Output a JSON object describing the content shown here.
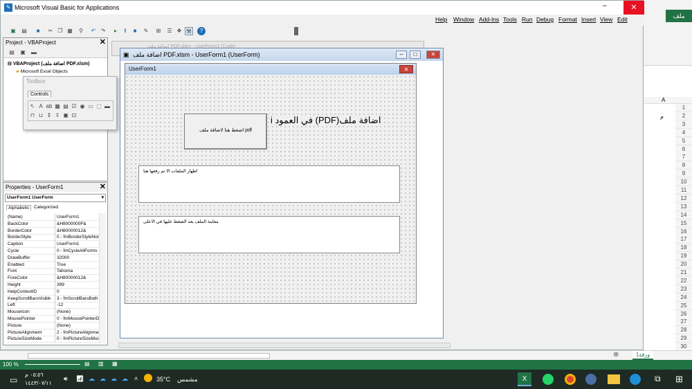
{
  "vba": {
    "title": "Microsoft Visual Basic for Applications",
    "menu": [
      "Help",
      "Window",
      "Add-Ins",
      "Tools",
      "Run",
      "Debug",
      "Format",
      "Insert",
      "View",
      "Edit"
    ]
  },
  "project": {
    "header": "Project - VBAProject",
    "root": "VBAProject (اضافة ملف PDF.xlsm)",
    "child": "Microsoft Excel Objects"
  },
  "toolbox": {
    "title": "Toolbox",
    "tab": "Controls"
  },
  "properties": {
    "header": "Properties - UserForm1",
    "object": "UserForm1 UserForm",
    "tab_alpha": "Alphabetic",
    "tab_cat": "Categorized",
    "rows": [
      {
        "name": "(Name)",
        "value": "UserForm1"
      },
      {
        "name": "BackColor",
        "value": "&H8000000F&"
      },
      {
        "name": "BorderColor",
        "value": "&H80000012&"
      },
      {
        "name": "BorderStyle",
        "value": "0 - fmBorderStyleNon"
      },
      {
        "name": "Caption",
        "value": "UserForm1"
      },
      {
        "name": "Cycle",
        "value": "0 - fmCycleAllForms"
      },
      {
        "name": "DrawBuffer",
        "value": "32000"
      },
      {
        "name": "Enabled",
        "value": "True"
      },
      {
        "name": "Font",
        "value": "Tahoma"
      },
      {
        "name": "ForeColor",
        "value": "&H80000012&"
      },
      {
        "name": "Height",
        "value": "399"
      },
      {
        "name": "HelpContextID",
        "value": "0"
      },
      {
        "name": "KeepScrollBarsVisible",
        "value": "3 - fmScrollBarsBoth"
      },
      {
        "name": "Left",
        "value": "-12"
      },
      {
        "name": "MouseIcon",
        "value": "(None)"
      },
      {
        "name": "MousePointer",
        "value": "0 - fmMousePointerDe"
      },
      {
        "name": "Picture",
        "value": "(None)"
      },
      {
        "name": "PictureAlignment",
        "value": "2 - fmPictureAlignmen"
      },
      {
        "name": "PictureSizeMode",
        "value": "0 - fmPictureSizeMode"
      }
    ]
  },
  "code_window_title": "اضافة ملف PDF.xlsm - UserForm1 (Code)",
  "uf_window_title": "اضافة ملف PDF.xlsm - UserForm1 (UserForm)",
  "form": {
    "caption": "UserForm1",
    "label_main": "اضافة ملف(PDF) في العمود i",
    "button": "اضغط هنا لاضافة ملف pdf",
    "box1": "اظهار الملفات الا تم رفعها هنا",
    "box2": "معاينة الملف بعد الضغط عليها في الاعلى"
  },
  "excel": {
    "tab_file": "ملف",
    "col_a": "A",
    "cell_text": "م",
    "rows": [
      "1",
      "2",
      "3",
      "4",
      "5",
      "6",
      "7",
      "8",
      "9",
      "10",
      "11",
      "12",
      "13",
      "14",
      "15",
      "16",
      "17",
      "18",
      "19",
      "20",
      "21",
      "22",
      "23",
      "24",
      "25",
      "26",
      "27",
      "28",
      "29",
      "30"
    ],
    "sheet_tab": "ورقة1",
    "zoom": "100 %"
  },
  "taskbar": {
    "time": "٠٥:٥٦ م",
    "date": "١٤٤٣/٠٧/١١",
    "weather_temp": "35°C",
    "weather_text": "مشمس"
  },
  "colors": {
    "excel_green": "#217346",
    "close_red": "#e81123"
  }
}
